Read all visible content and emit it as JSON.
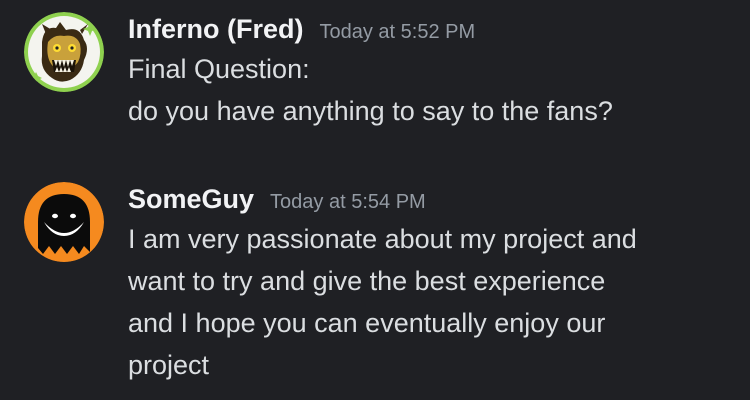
{
  "messages": [
    {
      "author": "Inferno (Fred)",
      "timestamp": "Today at 5:52 PM",
      "avatar_icon": "animatronic-avatar-icon",
      "lines": [
        "Final Question:",
        "do you have anything to say to the fans?"
      ]
    },
    {
      "author": "SomeGuy",
      "timestamp": "Today at 5:54 PM",
      "avatar_icon": "smiling-ghost-avatar-icon",
      "lines": [
        "I am very passionate about my project and",
        "want to try and give the best experience",
        "and I hope you can eventually enjoy our",
        "project"
      ]
    }
  ],
  "colors": {
    "background": "#1f2024",
    "username": "#f2f3f5",
    "timestamp": "#949ba4",
    "text": "#dbdee1",
    "avatar2_ring": "#f58a1f"
  }
}
